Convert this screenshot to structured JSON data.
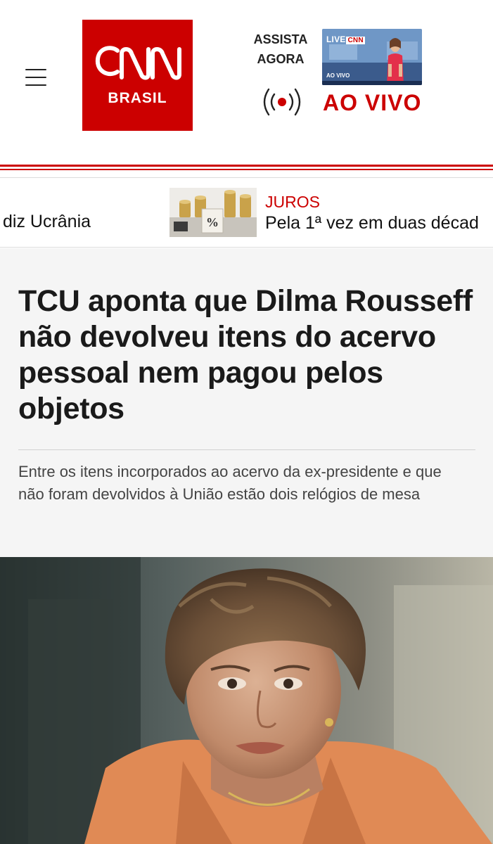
{
  "header": {
    "menu_icon": "hamburger-menu-icon",
    "logo": {
      "wordmark": "CNN",
      "sub": "BRASIL",
      "color": "#cc0000"
    },
    "watch_now": {
      "line1": "ASSISTA",
      "line2": "AGORA"
    },
    "live_thumbnail": {
      "tag": "LIVE",
      "brand": "CNN",
      "caption": "AO VIVO"
    },
    "live_icon": "broadcast-icon",
    "live_label": "AO VIVO"
  },
  "ticker": {
    "left_text": "diz Ucrânia",
    "item": {
      "kicker": "JUROS",
      "headline": "Pela 1ª vez em duas décad"
    }
  },
  "article": {
    "headline": "TCU aponta que Dilma Rousseff não devolveu itens do acervo pessoal nem pagou pelos objetos",
    "subtitle": "Entre os itens incorporados ao acervo da ex-presidente e que não foram devolvidos à União estão dois relógios de mesa"
  },
  "colors": {
    "brand_red": "#cc0000",
    "headline_text": "#1a1a1a",
    "article_bg": "#f5f5f5",
    "blazer": "#e08a55"
  }
}
